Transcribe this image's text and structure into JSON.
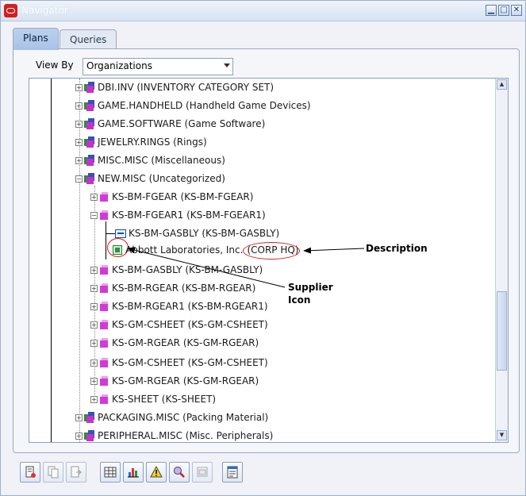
{
  "window": {
    "title": "Navigator"
  },
  "tabs": [
    {
      "label": "Plans",
      "active": true
    },
    {
      "label": "Queries",
      "active": false
    }
  ],
  "view_by": {
    "label": "View By",
    "value": "Organizations"
  },
  "tree": {
    "categories_top": [
      "DBI.INV (INVENTORY CATEGORY SET)",
      "GAME.HANDHELD (Handheld Game Devices)",
      "GAME.SOFTWARE (Game Software)",
      "JEWELRY.RINGS (Rings)",
      "MISC.MISC (Miscellaneous)",
      "NEW.MISC (Uncategorized)"
    ],
    "children": [
      "KS-BM-FGEAR (KS-BM-FGEAR)",
      "KS-BM-FGEAR1 (KS-BM-FGEAR1)"
    ],
    "grandchild": "KS-BM-GASBLY (KS-BM-GASBLY)",
    "supplier": {
      "name": "Abbott Laboratories, Inc.",
      "site": "(CORP HQ)"
    },
    "children_after": [
      "KS-BM-GASBLY (KS-BM-GASBLY)",
      "KS-BM-RGEAR (KS-BM-RGEAR)",
      "KS-BM-RGEAR1 (KS-BM-RGEAR1)",
      "KS-GM-CSHEET (KS-GM-CSHEET)",
      "KS-GM-RGEAR (KS-GM-RGEAR)",
      "KS-GM-CSHEET (KS-GM-CSHEET)",
      "KS-GM-RGEAR (KS-GM-RGEAR)",
      "KS-SHEET (KS-SHEET)"
    ],
    "categories_bottom": [
      "PACKAGING.MISC (Packing Material)",
      "PERIPHERAL.MISC (Misc. Peripherals)"
    ]
  },
  "annotations": {
    "description": "Description",
    "supplier_icon_line1": "Supplier",
    "supplier_icon_line2": "Icon"
  },
  "toolbar_icons": [
    "new-document-icon",
    "copy-document-icon",
    "move-document-icon",
    "grid-icon",
    "bar-chart-icon",
    "warning-icon",
    "search-magnify-icon",
    "window-icon",
    "report-icon"
  ]
}
